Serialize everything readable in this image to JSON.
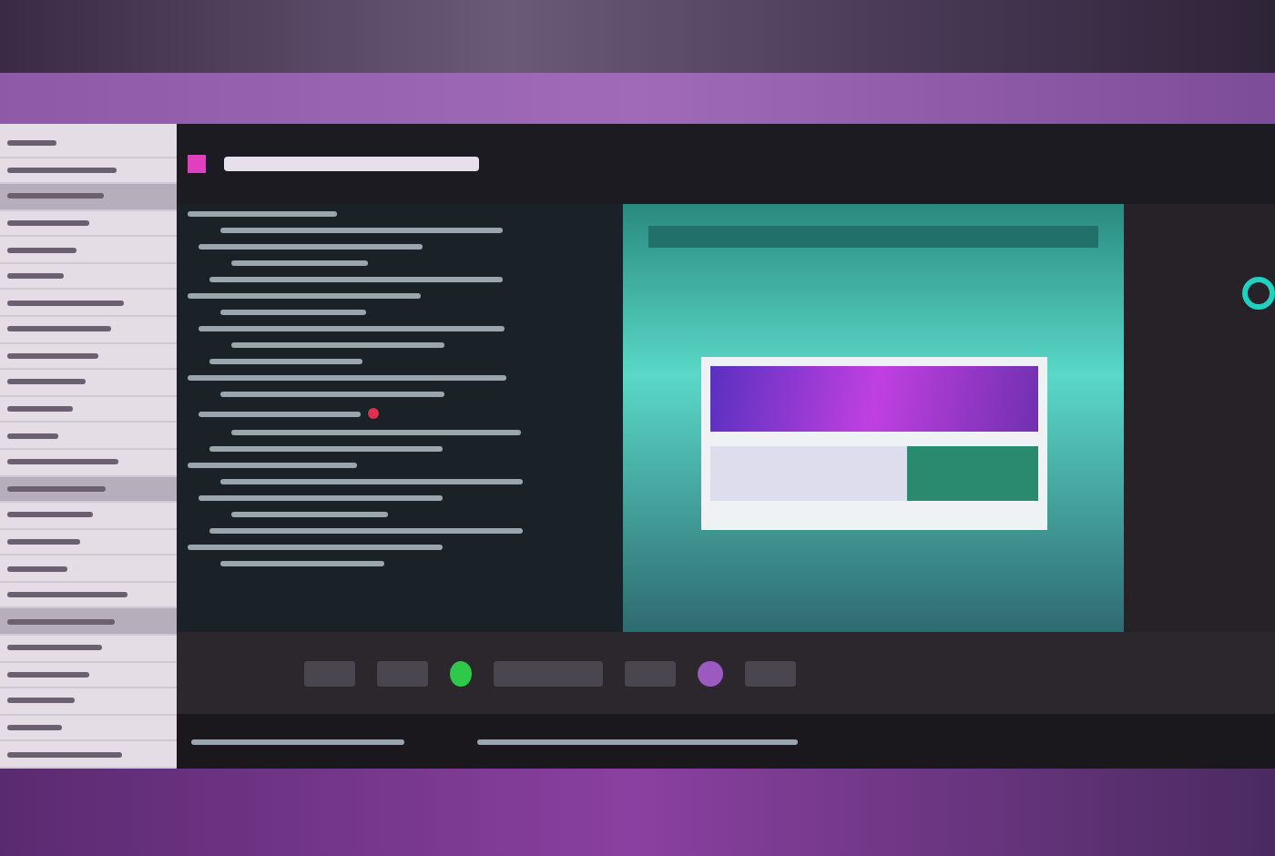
{
  "sidebar": {
    "rows": [
      {
        "selected": false
      },
      {
        "selected": false
      },
      {
        "selected": true
      },
      {
        "selected": false
      },
      {
        "selected": false
      },
      {
        "selected": false
      },
      {
        "selected": false
      },
      {
        "selected": false
      },
      {
        "selected": false
      },
      {
        "selected": false
      },
      {
        "selected": false
      },
      {
        "selected": false
      },
      {
        "selected": false
      },
      {
        "selected": true
      },
      {
        "selected": false
      },
      {
        "selected": false
      },
      {
        "selected": false
      },
      {
        "selected": false
      },
      {
        "selected": true
      },
      {
        "selected": false
      },
      {
        "selected": false
      },
      {
        "selected": false
      },
      {
        "selected": false
      },
      {
        "selected": false
      }
    ]
  },
  "editor": {
    "lines": [
      {
        "kind": "plain"
      },
      {
        "kind": "plain"
      },
      {
        "kind": "plain"
      },
      {
        "kind": "plain"
      },
      {
        "kind": "plain"
      },
      {
        "kind": "plain"
      },
      {
        "kind": "plain"
      },
      {
        "kind": "plain"
      },
      {
        "kind": "plain"
      },
      {
        "kind": "plain"
      },
      {
        "kind": "plain"
      },
      {
        "kind": "plain"
      },
      {
        "kind": "marked"
      },
      {
        "kind": "plain"
      },
      {
        "kind": "plain"
      },
      {
        "kind": "plain"
      },
      {
        "kind": "plain"
      },
      {
        "kind": "plain"
      },
      {
        "kind": "plain"
      },
      {
        "kind": "plain"
      },
      {
        "kind": "plain"
      },
      {
        "kind": "plain"
      }
    ]
  },
  "toolbar": {
    "toggle": {
      "on": true
    }
  }
}
